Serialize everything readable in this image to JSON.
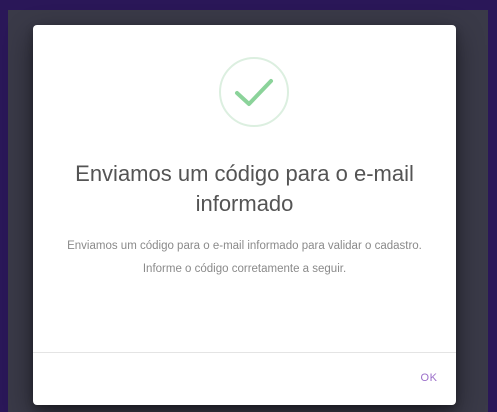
{
  "dialog": {
    "icon": "check-circle-icon",
    "title": "Enviamos um código para o e-mail informado",
    "message": "Enviamos um código para o e-mail informado para validar o cadastro. Informe o código corretamente a seguir.",
    "ok_label": "OK"
  },
  "colors": {
    "page_background": "#2a1758",
    "dialog_background": "#ffffff",
    "success_green": "#8bd39a",
    "accent_purple": "#9b6ec9"
  }
}
